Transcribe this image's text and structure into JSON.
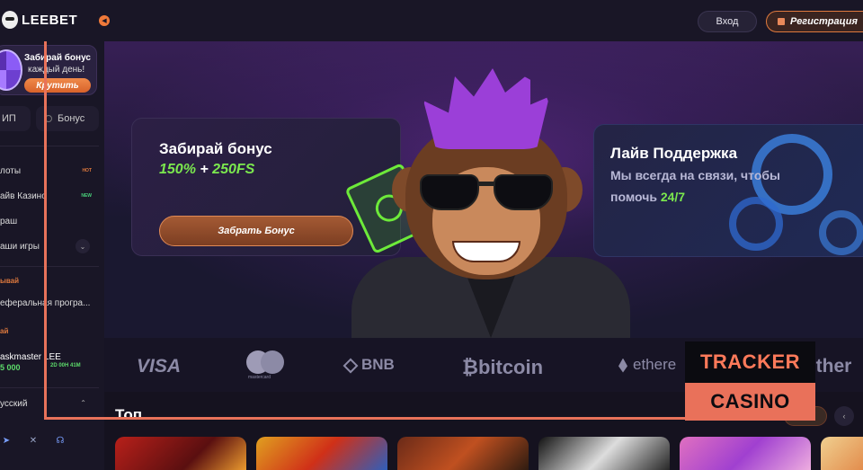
{
  "header": {
    "logo_text": "LEEBET",
    "login_label": "Вход",
    "register_label": "Регистрация"
  },
  "sidebar": {
    "wheel": {
      "title": "Забирай бонус",
      "subtitle": "каждый день!",
      "button": "Крутить"
    },
    "vip_label": "ИП",
    "bonus_label": "Бонус",
    "items": [
      {
        "label": "лоты",
        "badge": "HOT"
      },
      {
        "label": "айв Казино",
        "badge": "NEW"
      },
      {
        "label": "раш",
        "badge": ""
      },
      {
        "label": "аши игры",
        "badge": ""
      }
    ],
    "section_1": "ывай",
    "referral_label": "еферальная програ...",
    "section_2": "ай",
    "taskmaster": {
      "name": "askmaster LEE",
      "amount": "5 000",
      "timer": "2D 00H 41M"
    },
    "language": "усский"
  },
  "hero": {
    "promo": {
      "title": "Забирай бонус",
      "accent_part1": "150%",
      "accent_plus": "+",
      "accent_part2": "250FS",
      "button": "Забрать Бонус"
    },
    "support": {
      "title": "Лайв Поддержка",
      "line1": "Мы всегда на связи, чтобы",
      "line2_prefix": "помочь ",
      "line2_highlight": "24/7"
    }
  },
  "payments": {
    "visa": "VISA",
    "mastercard": "mastercard",
    "bnb": "BNB",
    "bitcoin": "bitcoin",
    "ethereum": "ethere",
    "tether": "ether"
  },
  "games": {
    "title": "Топ"
  },
  "overlay": {
    "tracker": "TRACKER",
    "casino": "CASINO"
  },
  "colors": {
    "accent_orange": "#e07a3e",
    "accent_green": "#7be84e",
    "overlay_coral": "#e9715a",
    "background": "#15121f"
  }
}
